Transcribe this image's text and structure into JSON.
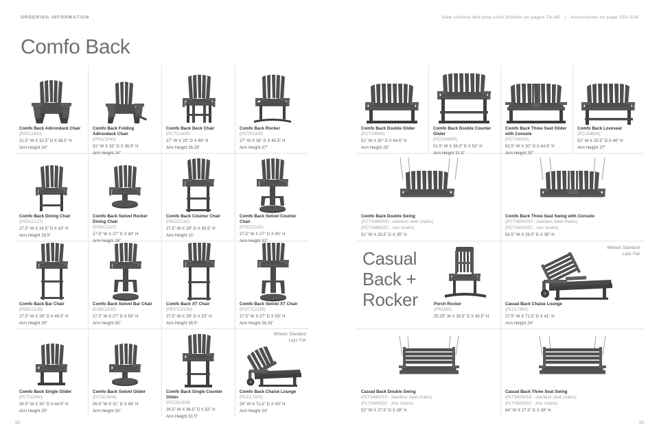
{
  "header": {
    "left_label": "ORDERING INFORMATION",
    "right_note": "View cushion and poly-color finishes on pages 74–80",
    "right_separator": "|",
    "right_note2": "Accessories on page 103–104"
  },
  "title": "Comfo Back",
  "section_title": "Casual\nBack +\nRocker",
  "section_title_lines": [
    "Casual",
    "Back +",
    "Rocker"
  ],
  "notes": {
    "wheels_chaise_right": "Wheels Standard\nLays Flat",
    "wheels_line1": "Wheels Standard",
    "wheels_line2": "Lays Flat"
  },
  "page_numbers": {
    "left": "92",
    "right": "93"
  },
  "colors": {
    "rule": "#e3e3e3",
    "name_text": "#2f2f2f",
    "code_text": "#9b9b9b",
    "dim_text": "#5a5a5a",
    "title_text": "#6e6e6e",
    "furniture_dark": "#4a4a4a",
    "furniture_mid": "#5c5c5c",
    "furniture_light": "#6e6e6e"
  },
  "products": [
    {
      "name": "Comfo Back Adirondack Chair",
      "code": "(PATC2400)",
      "dims": "31.5\" W X 32.5\" D X 38.5\" H",
      "arm": "Arm Height 24\""
    },
    {
      "name": "Comfo Back Folding Adirondack Chair",
      "code": "(PFAC3240)",
      "dims": "31\" W X 33\" D X 38.5\" H",
      "arm": "Arm Height 24\""
    },
    {
      "name": "Comfo Back Deck Chair",
      "code": "(PCTC2400)",
      "dims": "27\" W X 29\" D X 46\" H",
      "arm": "Arm Height 26.25\""
    },
    {
      "name": "Comfo Back Rocker",
      "code": "(PCTR2400)",
      "dims": "27\" W X 36\" D X 45.5\" H",
      "arm": "Arm Height 27\""
    },
    {
      "name": "Comfo Back Double Glider",
      "code": "(PCTG4800)",
      "dims": "51\" W X 30\" D X 44.5\" H",
      "arm": "Arm Height 25\""
    },
    {
      "name": "Comfo Back Double Counter Glider",
      "code": "(PCCG4800)",
      "dims": "51.5\" W X 36.5\" D X 52\" H",
      "arm": "Arm Height 31.5\""
    },
    {
      "name": "Comfo Back Three Seat Glider with Console",
      "code": "(PCTG6000)",
      "dims": "63.5\" W X 30\" D X 44.5\" H",
      "arm": "Arm Height 25\""
    },
    {
      "name": "Comfo Back Loveseat",
      "code": "(PCLS4600)",
      "dims": "51\" W X 30.5\" D X 46\" H",
      "arm": "Arm Height 27\""
    },
    {
      "name": "Comfo Back Dining Chair",
      "code": "(PEDC2127)",
      "dims": "27.5\" W X 24.5\" D X 42\" H",
      "arm": "Arm Height 26.5\""
    },
    {
      "name": "Comfo Back Swivel Rocker Dining Chair",
      "code": "(ESDC2127)",
      "dims": "27.5\" W X 27\" D X 40\" H",
      "arm": "Arm Height 26\""
    },
    {
      "name": "Comfo Back Counter Chair",
      "code": "(PECC2131)",
      "dims": "27.5\" W X 29\" D X 45.5\" H",
      "arm": "Arm Height 31\""
    },
    {
      "name": "Comfo Back Swivel Counter Chair",
      "code": "(ESCC2131)",
      "dims": "27.5\" W X 27\" D X 45\" H",
      "arm": "Arm Height 31\""
    },
    {
      "name": "Comfo Back Double Swing",
      "code": "(PCTS4800SS - stainless steel chains)",
      "code2": "(PCTS4800ZC - zinc chains)",
      "dims": "51\" W X 29.5\" D X 35\" H",
      "arm": ""
    },
    {
      "name": "Comfo Back Three Seat Swing with Console",
      "code": "(PCTS6000SS - stainless steel chains)",
      "code2": "(PCTS6000ZC - zinc chains)",
      "dims": "63.5\" W X 29.5\" D X 35\" H",
      "arm": ""
    },
    {
      "name": "Comfo Back Bar Chair",
      "code": "(PEBC2135)",
      "dims": "27.5\" W X 29\" D X 49.5\" H",
      "arm": "Arm Height 35\""
    },
    {
      "name": "Comfo Back Swivel Bar Chair",
      "code": "(ESBC2135)",
      "dims": "27.5\" W X 27\" D X 50\" H",
      "arm": "Arm Height 35\""
    },
    {
      "name": "Comfo Back XT Chair",
      "code": "(PEXTC2139)",
      "dims": "27.5\" W X 29\" D X 53\" H",
      "arm": "Arm Height 38.5\""
    },
    {
      "name": "Comfo Back Swivel XT Chair",
      "code": "(ESXTC2139)",
      "dims": "27.5\" W X 27\" D X 53\" H",
      "arm": "Arm Height 38.25\""
    },
    {
      "name": "Porch Rocker",
      "code": "(PR2545)",
      "dims": "25.25\" W X 36.5\" D X 45.5\" H",
      "arm": ""
    },
    {
      "name": "Casual Back Chaise Lounge",
      "code": "(PLCL7400)",
      "dims": "27.5\" W X 71.5\" D X 41\" H",
      "arm": "Arm Height 24\""
    },
    {
      "name": "Comfo Back Single Glider",
      "code": "(PCTG2400)",
      "dims": "26.5\" W X 30\" D X 44.5\" H",
      "arm": "Arm Height 25\""
    },
    {
      "name": "Comfo Back Swivel Glider",
      "code": "(PCSG2644)",
      "dims": "26.5\" W X 31\" D X 46\" H",
      "arm": "Arm Height 26\""
    },
    {
      "name": "Comfo Back Single Counter Glider",
      "code": "(PCCG2400)",
      "dims": "26.5\" W X 36.5\" D X 52\" H",
      "arm": "Arm Height 31.5\""
    },
    {
      "name": "Comfo Back Chaise Lounge",
      "code": "(PCCL7400)",
      "dims": "28\" W X 71.5\" D X 43\" H",
      "arm": "Arm Height 24\""
    },
    {
      "name": "Casual Back Double Swing",
      "code": "(PLTS4800SS - stainless steel chains)",
      "code2": "(PLTS4800ZC - zinc chains)",
      "dims": "52\" W X 27.5\" D X 28\" H",
      "arm": ""
    },
    {
      "name": "Casual Back Three Seat Swing",
      "code": "(PLTS6000SS - stainless steel chains)",
      "code2": "(PLTS6000ZC - zinc chains)",
      "dims": "64\" W X 27.5\" D X 28\" H",
      "arm": ""
    }
  ]
}
